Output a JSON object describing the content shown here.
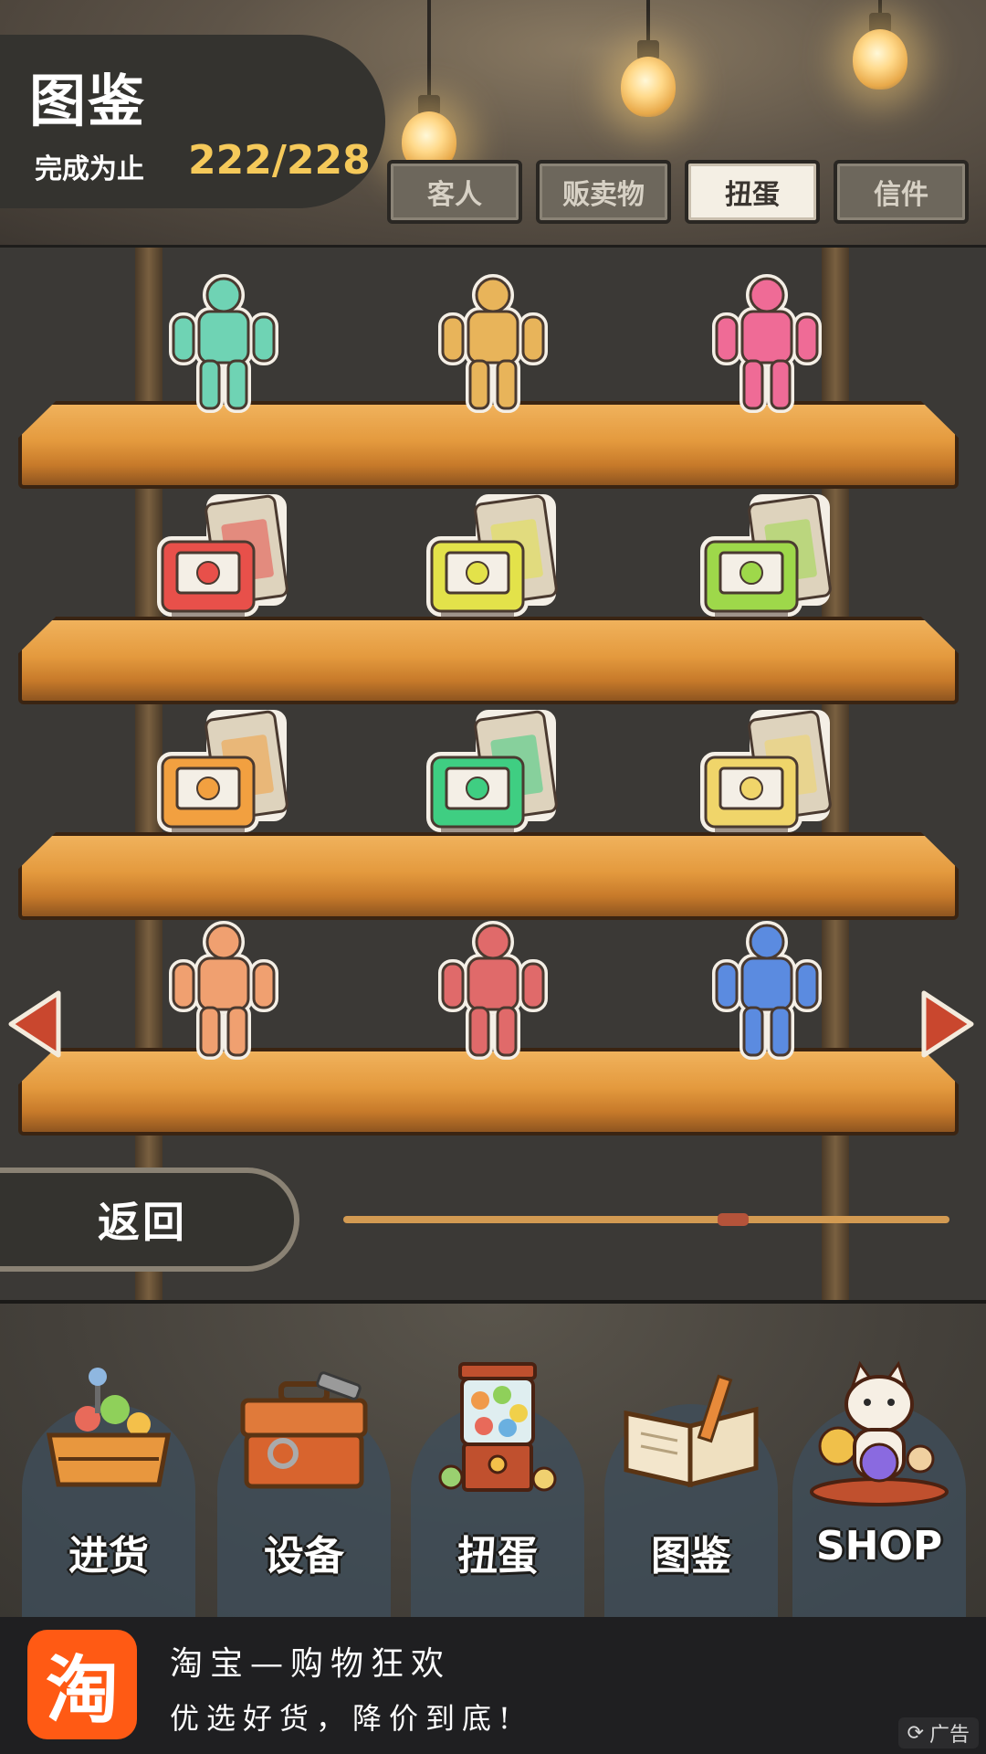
{
  "header": {
    "title": "图鉴",
    "progress_label": "完成为止",
    "progress_value": "222/228",
    "tabs": [
      {
        "label": "客人",
        "active": false
      },
      {
        "label": "贩卖物",
        "active": false
      },
      {
        "label": "扭蛋",
        "active": true
      },
      {
        "label": "信件",
        "active": false
      }
    ]
  },
  "shelves": [
    {
      "items": [
        {
          "kind": "figure",
          "name": "green-robot-figure",
          "color": "#6fd3b4"
        },
        {
          "kind": "figure",
          "name": "gold-warrior-figure",
          "color": "#e8b45a"
        },
        {
          "kind": "figure",
          "name": "pink-knight-figure",
          "color": "#ef6b96"
        }
      ]
    },
    {
      "items": [
        {
          "kind": "cartridge",
          "name": "red-game-cartridge",
          "color": "#e8504a"
        },
        {
          "kind": "cartridge",
          "name": "yellow-game-cartridge",
          "color": "#e3e24a"
        },
        {
          "kind": "cartridge",
          "name": "lime-game-cartridge",
          "color": "#9ed84a"
        }
      ]
    },
    {
      "items": [
        {
          "kind": "cartridge",
          "name": "orange-game-cartridge",
          "color": "#f2a040"
        },
        {
          "kind": "cartridge",
          "name": "green-game-cartridge",
          "color": "#3fce82"
        },
        {
          "kind": "cartridge",
          "name": "cream-game-cartridge",
          "color": "#f0d56a"
        }
      ]
    },
    {
      "items": [
        {
          "kind": "figure",
          "name": "orange-fighter-figure",
          "color": "#f0a070"
        },
        {
          "kind": "figure",
          "name": "red-martial-figure",
          "color": "#e06a6a"
        },
        {
          "kind": "figure",
          "name": "blue-beast-figure",
          "color": "#5b8be0"
        }
      ]
    }
  ],
  "pager": {
    "current_fraction": 0.65
  },
  "back_label": "返回",
  "bottom_nav": [
    {
      "label": "进货",
      "icon": "crate-icon"
    },
    {
      "label": "设备",
      "icon": "toolbox-icon"
    },
    {
      "label": "扭蛋",
      "icon": "gacha-machine-icon"
    },
    {
      "label": "图鉴",
      "icon": "book-icon"
    },
    {
      "label": "SHOP",
      "icon": "lucky-cat-icon"
    }
  ],
  "ad": {
    "logo_text": "淘",
    "title": "淘宝—购物狂欢",
    "subtitle": "优选好货，降价到底!",
    "tag": "广告"
  },
  "colors": {
    "accent_gold": "#f5c95a",
    "shelf_wood": "#e49a3e",
    "arrow_red": "#c9472e",
    "ad_orange": "#ff5a14"
  }
}
